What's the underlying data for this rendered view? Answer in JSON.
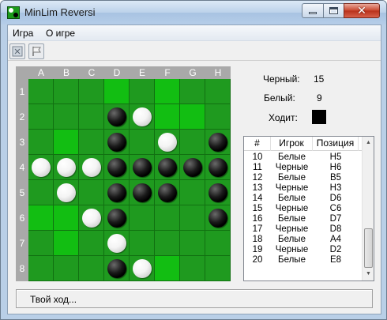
{
  "window": {
    "title": "MinLim Reversi"
  },
  "menu": [
    "Игра",
    "О игре"
  ],
  "board": {
    "columns": [
      "A",
      "B",
      "C",
      "D",
      "E",
      "F",
      "G",
      "H"
    ],
    "rows": [
      "1",
      "2",
      "3",
      "4",
      "5",
      "6",
      "7",
      "8"
    ],
    "highlighted": [
      "D1",
      "F1",
      "F2",
      "G2",
      "B3",
      "A6",
      "B6",
      "B7",
      "F8"
    ],
    "discs": {
      "D2": "black",
      "E2": "white",
      "D3": "black",
      "F3": "white",
      "H3": "black",
      "A4": "white",
      "B4": "white",
      "C4": "white",
      "D4": "black",
      "E4": "black",
      "F4": "black",
      "G4": "black",
      "H4": "black",
      "B5": "white",
      "D5": "black",
      "E5": "black",
      "F5": "black",
      "H5": "black",
      "C6": "white",
      "D6": "black",
      "H6": "black",
      "D7": "white",
      "D8": "black",
      "E8": "white"
    }
  },
  "score": {
    "black_label": "Черный:",
    "black_value": "15",
    "white_label": "Белый:",
    "white_value": "9",
    "turn_label": "Ходит:",
    "turn_color": "#000000"
  },
  "moves": {
    "headers": [
      "#",
      "Игрок",
      "Позиция"
    ],
    "rows": [
      [
        "10",
        "Белые",
        "H5"
      ],
      [
        "11",
        "Черные",
        "H6"
      ],
      [
        "12",
        "Белые",
        "B5"
      ],
      [
        "13",
        "Черные",
        "H3"
      ],
      [
        "14",
        "Белые",
        "D6"
      ],
      [
        "15",
        "Черные",
        "C6"
      ],
      [
        "16",
        "Белые",
        "D7"
      ],
      [
        "17",
        "Черные",
        "D8"
      ],
      [
        "18",
        "Белые",
        "A4"
      ],
      [
        "19",
        "Черные",
        "D2"
      ],
      [
        "20",
        "Белые",
        "E8"
      ]
    ]
  },
  "status": {
    "text": "Твой ход..."
  }
}
